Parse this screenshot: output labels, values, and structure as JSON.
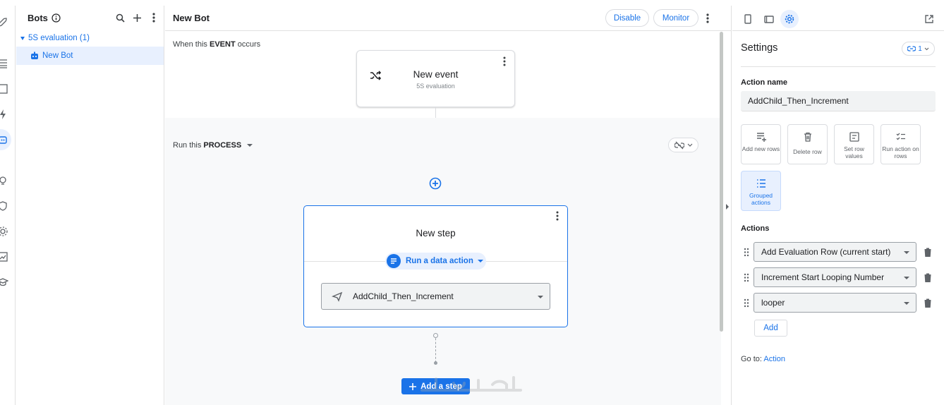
{
  "bots_panel": {
    "title": "Bots",
    "group_label": "5S evaluation (1)",
    "item_label": "New Bot"
  },
  "main": {
    "title": "New Bot",
    "disable_label": "Disable",
    "monitor_label": "Monitor",
    "event_prefix": "When this",
    "event_keyword": "EVENT",
    "event_suffix": "occurs",
    "event_card": {
      "title": "New event",
      "subtitle": "5S evaluation"
    },
    "process_prefix": "Run this",
    "process_keyword": "PROCESS",
    "step": {
      "title": "New step",
      "chip_label": "Run a data action",
      "selected_action": "AddChild_Then_Increment"
    },
    "add_step_label": "Add a step"
  },
  "settings": {
    "title": "Settings",
    "version_label": "1",
    "action_name_label": "Action name",
    "action_name_value": "AddChild_Then_Increment",
    "tiles": [
      {
        "label": "Add new rows",
        "icon": "add-rows-icon"
      },
      {
        "label": "Delete row",
        "icon": "trash-icon"
      },
      {
        "label": "Set row values",
        "icon": "set-values-icon"
      },
      {
        "label": "Run action on rows",
        "icon": "checklist-icon"
      },
      {
        "label": "Grouped actions",
        "icon": "list-icon"
      }
    ],
    "actions_label": "Actions",
    "actions": [
      "Add Evaluation Row (current start)",
      "Increment Start Looping Number",
      "looper"
    ],
    "add_label": "Add",
    "goto_prefix": "Go to:",
    "goto_link": "Action"
  },
  "colors": {
    "accent": "#1a73e8",
    "selected_bg": "#e8f0fe"
  }
}
